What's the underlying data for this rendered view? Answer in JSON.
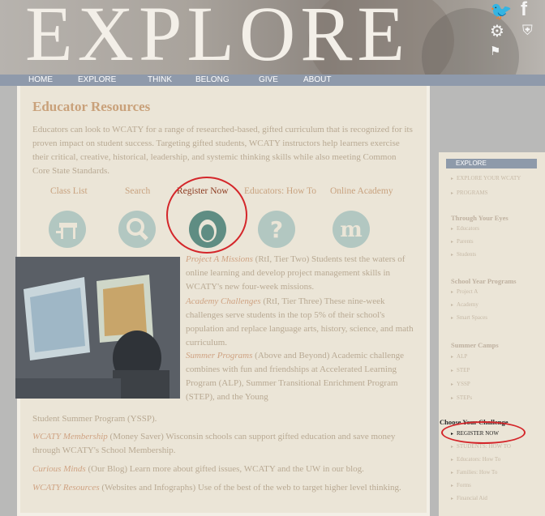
{
  "header": {
    "logo": "EXPLORE",
    "icons": [
      "twitter-icon",
      "facebook-icon",
      "gear-icon",
      "shield-icon",
      "flag-icon"
    ]
  },
  "nav": [
    "HOME",
    "EXPLORE",
    "THINK",
    "BELONG",
    "GIVE",
    "ABOUT"
  ],
  "page_title": "Educator Resources",
  "intro": "Educators can look to WCATY for a range of researched-based, gifted curriculum that is recognized for its proven impact on student success. Targeting gifted students, WCATY instructors help learners exercise their critical, creative, historical, leadership, and systemic thinking skills while also meeting Common Core State Standards.",
  "tabs": [
    "Class List",
    "Search",
    "Register Now",
    "Educators: How To",
    "Online Academy"
  ],
  "paragraphs": {
    "p1_em": "Project A Missions",
    "p1": " (RtI, Tier Two) Students test the waters of online learning and develop project management skills in WCATY's new four-week missions.",
    "p2_em": "Academy Challenges",
    "p2": " (RtI, Tier Three) These nine-week challenges serve students in the top 5% of their school's population and replace language arts, history, science, and math curriculum.",
    "p3_em": "Summer Programs",
    "p3": " (Above and Beyond) Academic challenge combines with fun and friendships at Accelerated Learning Program (ALP), Summer Transitional Enrichment Program (STEP), and the Young",
    "p3_tail": "Student Summer Program (YSSP).",
    "p4_em": "WCATY Membership",
    "p4": " (Money Saver) Wisconsin schools can support gifted education and save money through WCATY's School Membership.",
    "p5_em": "Curious Minds",
    "p5": " (Our Blog) Learn more about gifted issues, WCATY and the UW in our blog.",
    "p6_em": "WCATY Resources",
    "p6": " (Websites and Infographs) Use of the best of the web to target higher level thinking."
  },
  "sidebar": {
    "head": "EXPLORE",
    "top_links": [
      "EXPLORE YOUR WCATY",
      "PROGRAMS"
    ],
    "groups": [
      {
        "title": "Through Your Eyes",
        "links": [
          "Educators",
          "Parents",
          "Students"
        ]
      },
      {
        "title": "School Year Programs",
        "links": [
          "Project A",
          "Academy",
          "Smart Spaces"
        ]
      },
      {
        "title": "Summer Camps",
        "links": [
          "ALP",
          "STEP",
          "YSSP",
          "STEPs"
        ]
      }
    ],
    "challenge_title": "Choose Your Challenge",
    "challenge_links": [
      "REGISTER NOW",
      "STUDENTS: HOW TO",
      "Educators: How To",
      "Families: How To",
      "Forms",
      "Financial Aid"
    ]
  }
}
